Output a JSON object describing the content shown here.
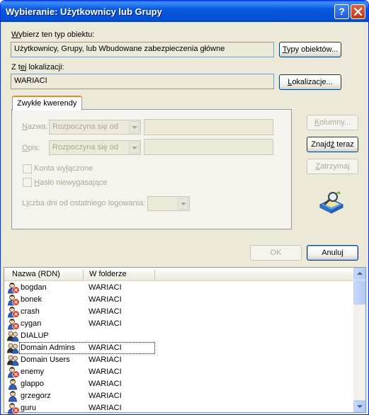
{
  "window": {
    "title": "Wybieranie: Użytkownicy lub Grupy",
    "help_glyph": "?",
    "close_glyph": "✕"
  },
  "object_type": {
    "label_underlined": "W",
    "label_rest": "ybierz ten typ obiektu:",
    "value": "Użytkownicy, Grupy, lub Wbudowane zabezpieczenia główne",
    "button_underlined": "T",
    "button_rest": "ypy obiektów..."
  },
  "location": {
    "label_pre": "Z t",
    "label_underlined": "e",
    "label_rest": "j lokalizacji:",
    "value": "WARIACI",
    "button_underlined": "L",
    "button_rest": "okalizacje..."
  },
  "tab": {
    "label": "Zwykłe kwerendy"
  },
  "query": {
    "name_label_underlined": "N",
    "name_label_rest": "azwa:",
    "name_mode": "Rozpoczyna się od",
    "desc_label_underlined": "O",
    "desc_label_rest": "pis:",
    "desc_mode": "Rozpoczyna się od",
    "disabled_accounts_pre": "Konta wy",
    "disabled_accounts_underlined": "ł",
    "disabled_accounts_rest": "ączone",
    "non_expiring_underlined": "H",
    "non_expiring_rest": "asło niewygasające",
    "days_label_pre": "L",
    "days_label_underlined": "i",
    "days_label_rest": "czba dni od ostatniego logowania:"
  },
  "side_buttons": {
    "columns_underlined": "K",
    "columns_rest": "olumny...",
    "find_pre": "Znajd",
    "find_underlined": "ź",
    "find_rest": " teraz",
    "stop_underlined": "Z",
    "stop_rest": "atrzymaj"
  },
  "dialog_buttons": {
    "ok": "OK",
    "cancel": "Anuluj"
  },
  "results": {
    "columns": [
      "Nazwa (RDN)",
      "W folderze"
    ],
    "rows": [
      {
        "name": "bogdan",
        "folder": "WARIACI",
        "icon": "disabled-user-icon"
      },
      {
        "name": "bonek",
        "folder": "WARIACI",
        "icon": "disabled-user-icon"
      },
      {
        "name": "crash",
        "folder": "WARIACI",
        "icon": "disabled-user-icon"
      },
      {
        "name": "cygan",
        "folder": "WARIACI",
        "icon": "disabled-user-icon"
      },
      {
        "name": "DIALUP",
        "folder": "",
        "icon": "group-icon"
      },
      {
        "name": "Domain Admins",
        "folder": "WARIACI",
        "icon": "group-icon"
      },
      {
        "name": "Domain Users",
        "folder": "WARIACI",
        "icon": "group-icon"
      },
      {
        "name": "enemy",
        "folder": "WARIACI",
        "icon": "disabled-user-icon"
      },
      {
        "name": "glappo",
        "folder": "WARIACI",
        "icon": "user-icon"
      },
      {
        "name": "grzegorz",
        "folder": "WARIACI",
        "icon": "user-icon"
      },
      {
        "name": "guru",
        "folder": "WARIACI",
        "icon": "disabled-user-icon"
      }
    ]
  },
  "colors": {
    "titlebar": "#0450d6",
    "dialog_bg": "#ece9d8",
    "disabled_text": "#aca899",
    "tab_accent": "#e68b2c",
    "disabled_badge": "#e0301e"
  }
}
